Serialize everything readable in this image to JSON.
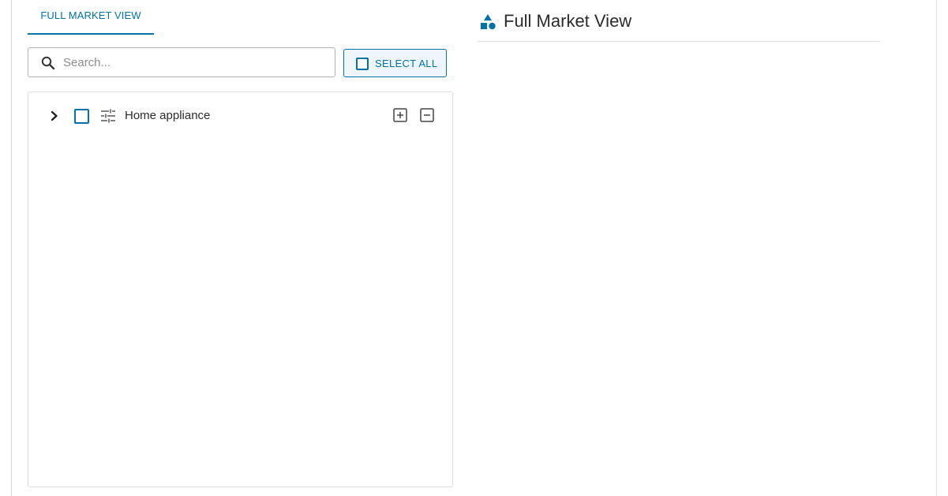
{
  "tabs": [
    {
      "label": "FULL MARKET VIEW",
      "active": true
    }
  ],
  "search": {
    "placeholder": "Search...",
    "value": ""
  },
  "select_all": {
    "label": "SELECT ALL",
    "checked": false
  },
  "tree": {
    "items": [
      {
        "label": "Home appliance",
        "expanded": false,
        "checked": false,
        "icon": "tune-icon"
      }
    ]
  },
  "detail": {
    "title": "Full Market View",
    "icon": "shapes-icon"
  },
  "colors": {
    "accent": "#0072a3",
    "accent_bg": "#eef6fb",
    "border": "#dcdcdc",
    "text": "#2b2b2b"
  }
}
